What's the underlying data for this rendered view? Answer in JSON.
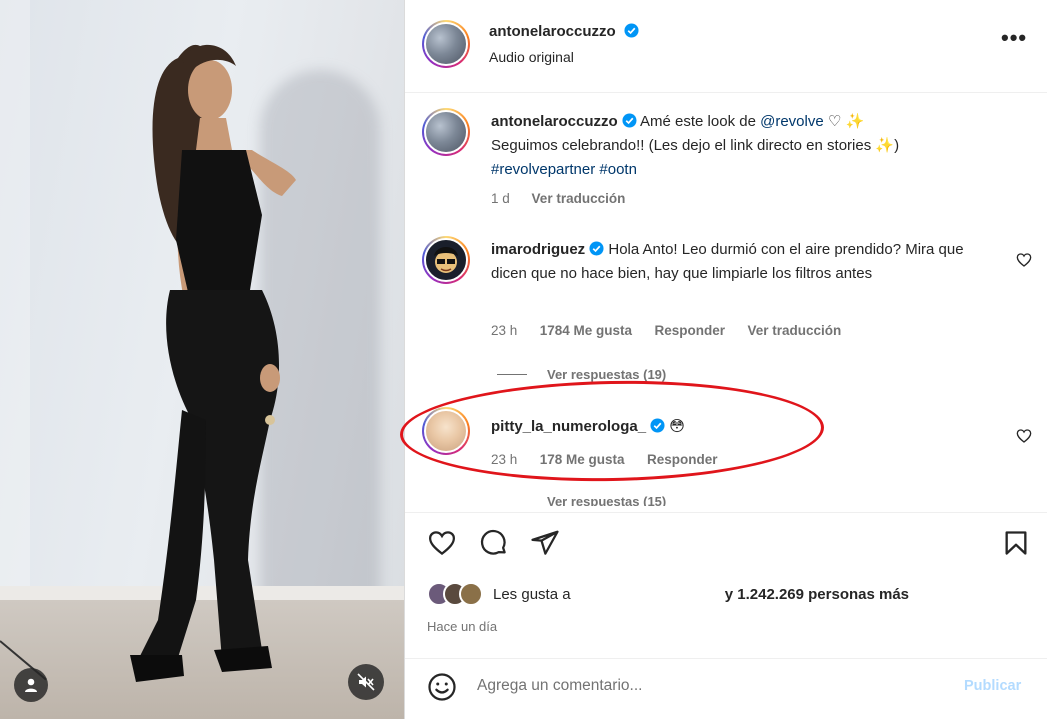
{
  "post": {
    "username": "antonelaroccuzzo",
    "audio": "Audio original",
    "more_icon": "more-horizontal-icon"
  },
  "caption": {
    "username": "antonelaroccuzzo",
    "text_1": "Amé este look de ",
    "mention": "@revolve",
    "emoji_1": "♡ ✨",
    "text_2": "Seguimos celebrando!! (Les dejo el link directo en stories ",
    "emoji_2": "✨",
    "text_2_end": ")",
    "hashtags": "#revolvepartner #ootn",
    "time": "1 d",
    "translate": "Ver traducción"
  },
  "comments": [
    {
      "username": "imarodriguez",
      "text": "Hola Anto! Leo durmió con el aire prendido? Mira que dicen que no hace bien, hay que limpiarle los filtros antes",
      "time": "23 h",
      "likes": "1784 Me gusta",
      "reply": "Responder",
      "translate": "Ver traducción",
      "view_replies": "Ver respuestas (19)"
    },
    {
      "username": "pitty_la_numerologa_",
      "emoji": "😳",
      "time": "23 h",
      "likes": "178 Me gusta",
      "reply": "Responder",
      "view_replies": "Ver respuestas (15)"
    }
  ],
  "likes_row": {
    "prefix": "Les gusta a",
    "suffix": "y 1.242.269 personas más"
  },
  "time_ago": "Hace un día",
  "add_comment": {
    "placeholder": "Agrega un comentario...",
    "publish": "Publicar"
  },
  "colors": {
    "verified": "#0095f6",
    "highlight_ellipse": "#e0151b",
    "link": "#00376b",
    "publish_disabled": "#b3dbff"
  }
}
